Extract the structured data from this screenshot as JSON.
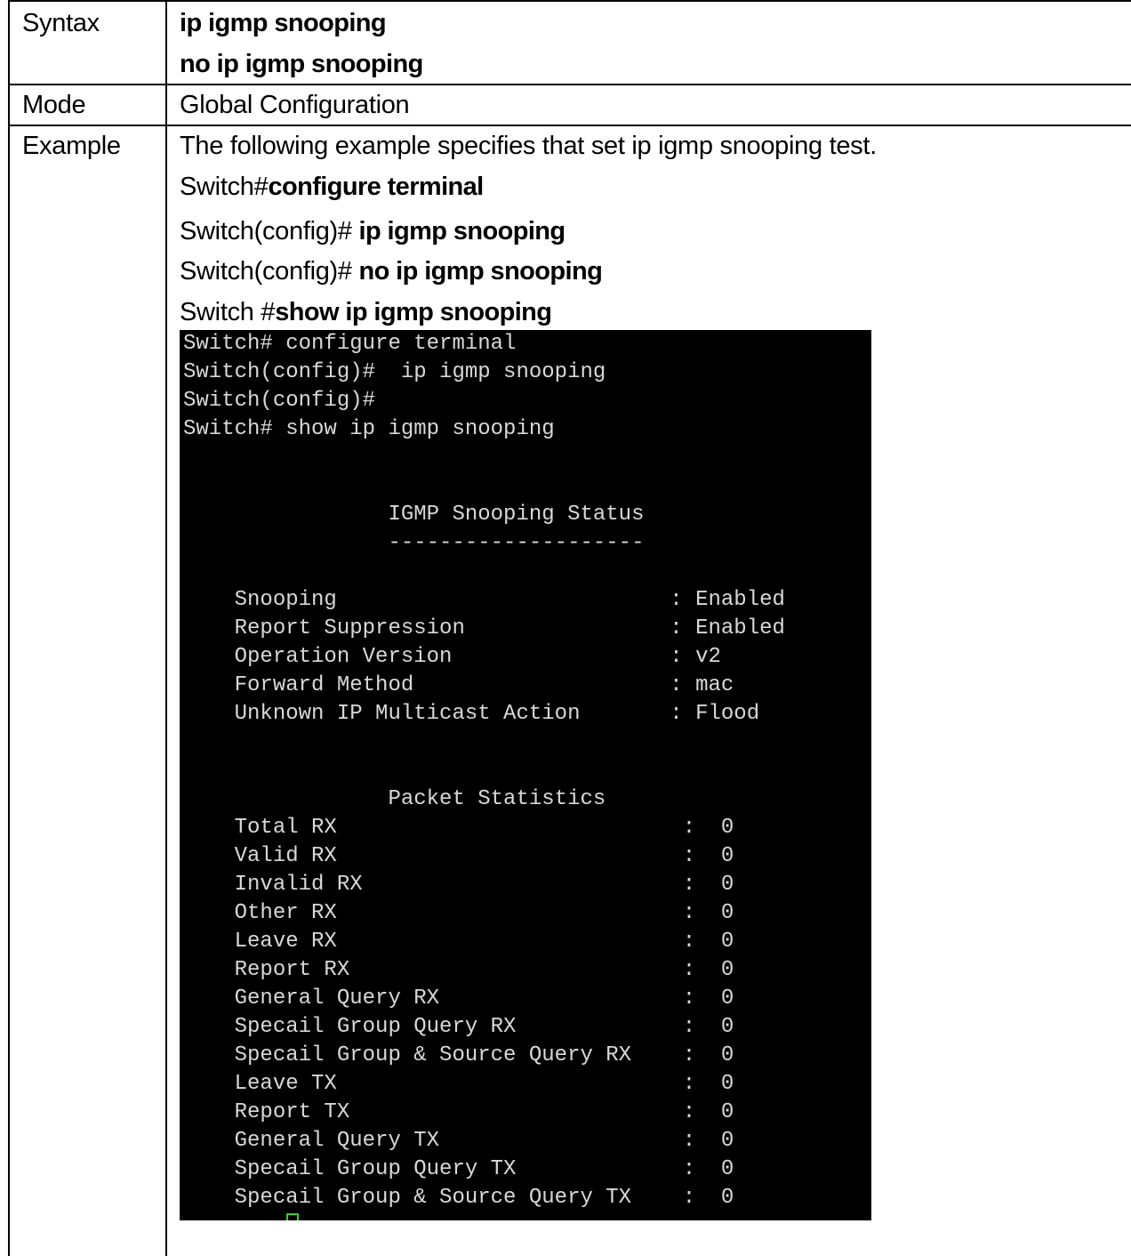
{
  "rows": {
    "syntax": {
      "label": "Syntax",
      "line1": "ip igmp snooping",
      "line2": "no ip igmp snooping"
    },
    "mode": {
      "label": "Mode",
      "value": "Global Configuration"
    },
    "example": {
      "label": "Example",
      "description": "The following example specifies that set ip igmp snooping test.",
      "cmd1_prefix": "Switch#",
      "cmd1": "configure terminal",
      "cmd2_prefix": "Switch(config)# ",
      "cmd2": "ip igmp snooping",
      "cmd3_prefix": "Switch(config)# ",
      "cmd3": "no ip igmp snooping",
      "cmd4_prefix": "Switch #",
      "cmd4": "show ip igmp snooping"
    }
  },
  "terminal": {
    "lines": [
      "Switch# configure terminal",
      "Switch(config)#  ip igmp snooping",
      "Switch(config)#",
      "Switch# show ip igmp snooping",
      "",
      "",
      "                IGMP Snooping Status",
      "                --------------------",
      "",
      "",
      "    Snooping                          : Enabled",
      "    Report Suppression                : Enabled",
      "    Operation Version                 : v2",
      "    Forward Method                    : mac",
      "    Unknown IP Multicast Action       : Flood",
      "",
      "",
      "",
      "                Packet Statistics",
      "    Total RX                           :  0",
      "    Valid RX                           :  0",
      "    Invalid RX                         :  0",
      "    Other RX                           :  0",
      "    Leave RX                           :  0",
      "    Report RX                          :  0",
      "    General Query RX                   :  0",
      "    Specail Group Query RX             :  0",
      "    Specail Group & Source Query RX    :  0",
      "    Leave TX                           :  0",
      "    Report TX                          :  0",
      "    General Query TX                   :  0",
      "    Specail Group Query TX             :  0",
      "    Specail Group & Source Query TX    :  0"
    ],
    "cursor_color": "#2fd32f"
  }
}
